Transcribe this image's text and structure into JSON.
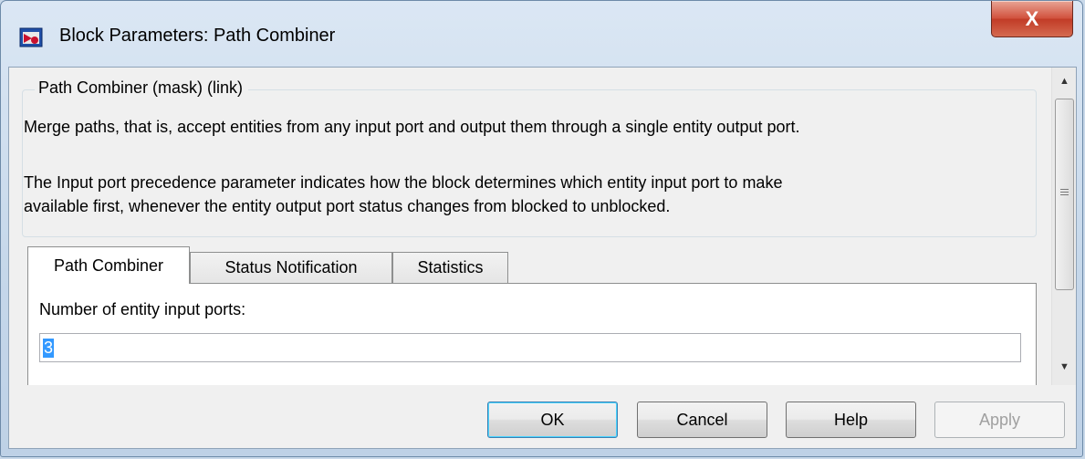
{
  "window": {
    "title": "Block Parameters: Path Combiner",
    "close_label": "X"
  },
  "mask": {
    "group_label": "Path Combiner (mask) (link)",
    "description_1": "Merge paths, that is, accept entities from any input port and output them through a single entity output port.",
    "description_2_line1": "The Input port precedence parameter indicates how the block determines which entity input port to make",
    "description_2_line2": "available first, whenever the entity output port status changes from blocked to unblocked."
  },
  "tabs": [
    {
      "label": "Path Combiner",
      "active": true
    },
    {
      "label": "Status Notification",
      "active": false
    },
    {
      "label": "Statistics",
      "active": false
    }
  ],
  "fields": {
    "num_input_ports_label": "Number of entity input ports:",
    "num_input_ports_value": "3"
  },
  "buttons": {
    "ok": "OK",
    "cancel": "Cancel",
    "help": "Help",
    "apply": "Apply"
  },
  "scrollbar": {
    "up_arrow": "▲",
    "down_arrow": "▼"
  },
  "colors": {
    "selection": "#3399ff",
    "close_button": "#c23c27"
  }
}
